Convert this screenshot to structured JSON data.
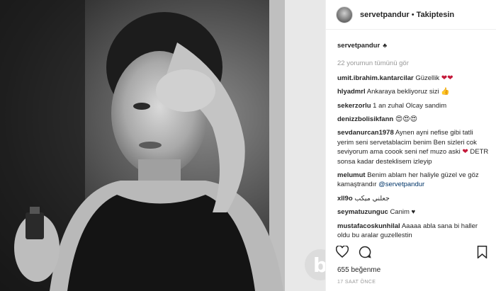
{
  "post": {
    "username": "servetpandur",
    "dot": "•",
    "follow_state": "Takiptesin",
    "caption_suffix": "♣",
    "view_all": "22 yorumun tümünü gör",
    "likes": "655 beğenme",
    "time": "17 SAAT ÖNCE"
  },
  "watermark_glyph": "b",
  "comments": [
    {
      "user": "umit.ibrahim.kantarcilar",
      "text": "Güzellik",
      "emoji": "❤❤"
    },
    {
      "user": "hlyadmrl",
      "text": "Ankaraya bekliyoruz sizi",
      "emoji": "👍"
    },
    {
      "user": "sekerzorlu",
      "text": "1 an zuhal Olcay sandim",
      "emoji": ""
    },
    {
      "user": "denizzbolisikfann",
      "text": "",
      "emoji": "😍😍😍"
    },
    {
      "user": "sevdanurcan1978",
      "text": "Aynen ayni nefise gibi tatli yerim seni servetablacim benim Ben sizleri cok seviyorum ama coook seni nef muzo aski",
      "emoji": "❤",
      "text2": "DETR sonsa kadar desteklisem izleyip"
    },
    {
      "user": "melumut",
      "text": "Benim ablam her haliyle güzel ve göz kamaştrandır",
      "mention": "@servetpandur"
    },
    {
      "user": "xll9o",
      "text": "جعلني ميكب",
      "emoji": ""
    },
    {
      "user": "seymatuzunguc",
      "text": "Canim",
      "emoji": "♥"
    },
    {
      "user": "mustafacoskunhilal",
      "text": "Aaaaa abla sana bi haller oldu bu aralar guzellestin",
      "emoji": ""
    }
  ],
  "icons": [
    "heart-icon",
    "comment-icon",
    "bookmark-icon",
    "club-icon"
  ],
  "colors": {
    "accent_heart": "#c4193a",
    "mention": "#003569",
    "muted": "#999999"
  }
}
